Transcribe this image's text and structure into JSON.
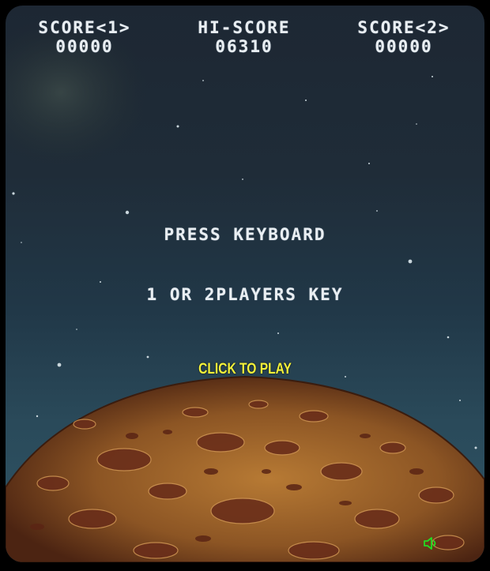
{
  "hud": {
    "score1_label": "SCORE<1>",
    "score1_value": "00000",
    "hiscore_label": "HI-SCORE",
    "hiscore_value": "06310",
    "score2_label": "SCORE<2>",
    "score2_value": "00000"
  },
  "attract": {
    "press_keyboard": "PRESS KEYBOARD",
    "players_key": "1 OR 2PLAYERS KEY",
    "click_to_play": "CLICK TO PLAY"
  },
  "controls": {
    "sound_icon": "speaker-icon",
    "sound_color": "#22dd22"
  },
  "colors": {
    "hud_text": "#e9eef2",
    "click_to_play": "#f4f23a",
    "planet_base": "#a86d2c"
  }
}
